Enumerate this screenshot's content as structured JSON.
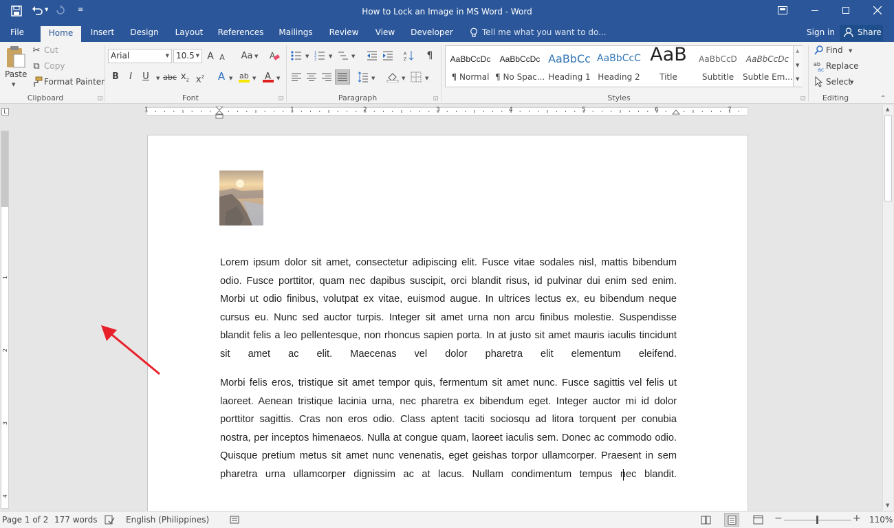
{
  "window": {
    "title": "How to Lock an Image in MS Word - Word"
  },
  "titlebar": {
    "save_icon": "save-icon",
    "undo_icon": "undo-icon",
    "redo_icon": "redo-icon"
  },
  "tabs": [
    {
      "label": "File",
      "active": false
    },
    {
      "label": "Home",
      "active": true
    },
    {
      "label": "Insert",
      "active": false
    },
    {
      "label": "Design",
      "active": false
    },
    {
      "label": "Layout",
      "active": false
    },
    {
      "label": "References",
      "active": false
    },
    {
      "label": "Mailings",
      "active": false
    },
    {
      "label": "Review",
      "active": false
    },
    {
      "label": "View",
      "active": false
    },
    {
      "label": "Developer",
      "active": false
    }
  ],
  "tell_me": {
    "placeholder": "Tell me what you want to do..."
  },
  "account": {
    "sign_in": "Sign in",
    "share": "Share"
  },
  "clipboard": {
    "paste": "Paste",
    "cut": "Cut",
    "copy": "Copy",
    "format_painter": "Format Painter",
    "group": "Clipboard"
  },
  "font": {
    "name": "Arial",
    "size": "10.5",
    "group": "Font",
    "grow": "A",
    "shrink": "A",
    "case": "Aa",
    "bold": "B",
    "italic": "I",
    "underline": "U",
    "strike": "abc",
    "subscript": "x",
    "superscript": "x",
    "effects": "A",
    "color": "A"
  },
  "paragraph": {
    "group": "Paragraph",
    "pilcrow": "¶"
  },
  "styles": {
    "group": "Styles",
    "items": [
      {
        "preview": "AaBbCcDc",
        "name": "¶ Normal"
      },
      {
        "preview": "AaBbCcDc",
        "name": "¶ No Spac..."
      },
      {
        "preview": "AaBbCc",
        "name": "Heading 1"
      },
      {
        "preview": "AaBbCcC",
        "name": "Heading 2"
      },
      {
        "preview": "AaB",
        "name": "Title"
      },
      {
        "preview": "AaBbCcD",
        "name": "Subtitle"
      },
      {
        "preview": "AaBbCcDc",
        "name": "Subtle Em..."
      }
    ]
  },
  "editing": {
    "find": "Find",
    "replace": "Replace",
    "select": "Select",
    "group": "Editing"
  },
  "ruler": {
    "numbers": [
      "1",
      "1",
      "2",
      "3",
      "4",
      "5",
      "6",
      "7"
    ],
    "v_numbers": [
      "1",
      "2",
      "3",
      "4"
    ]
  },
  "document": {
    "paragraph1": "Lorem ipsum dolor sit amet, consectetur adipiscing elit. Fusce vitae sodales nisl, mattis bibendum odio. Fusce porttitor, quam nec dapibus suscipit, orci blandit risus, id pulvinar dui enim sed enim. Morbi ut odio finibus, volutpat ex vitae, euismod augue. In ultrices lectus ex, eu bibendum neque cursus eu. Nunc sed auctor turpis. Integer sit amet urna non arcu finibus molestie. Suspendisse blandit felis a leo pellentesque, non rhoncus sapien porta. In at justo sit amet mauris iaculis tincidunt sit amet ac elit. Maecenas vel dolor pharetra elit elementum eleifend.",
    "paragraph2": "Morbi felis eros, tristique sit amet tempor quis, fermentum sit amet nunc. Fusce sagittis vel felis ut laoreet. Aenean tristique lacinia urna, nec pharetra ex bibendum eget. Integer auctor mi id dolor porttitor sagittis. Cras non eros odio. Class aptent taciti sociosqu ad litora torquent per conubia nostra, per inceptos himenaeos. Nulla at congue quam, laoreet iaculis sem. Donec ac commodo odio. Quisque pretium metus sit amet nunc venenatis, eget geishas torpor ullamcorper. Praesent in sem pharetra urna ullamcorper dignissim ac at lacus. Nullam condimentum tempus nec blandit."
  },
  "status": {
    "page": "Page 1 of 2",
    "words": "177 words",
    "language": "English (Philippines)",
    "zoom": "110%"
  },
  "colors": {
    "accent": "#2b579a",
    "arrow": "#e8202a",
    "highlight": "#f7e600",
    "font_color": "#e02020"
  }
}
